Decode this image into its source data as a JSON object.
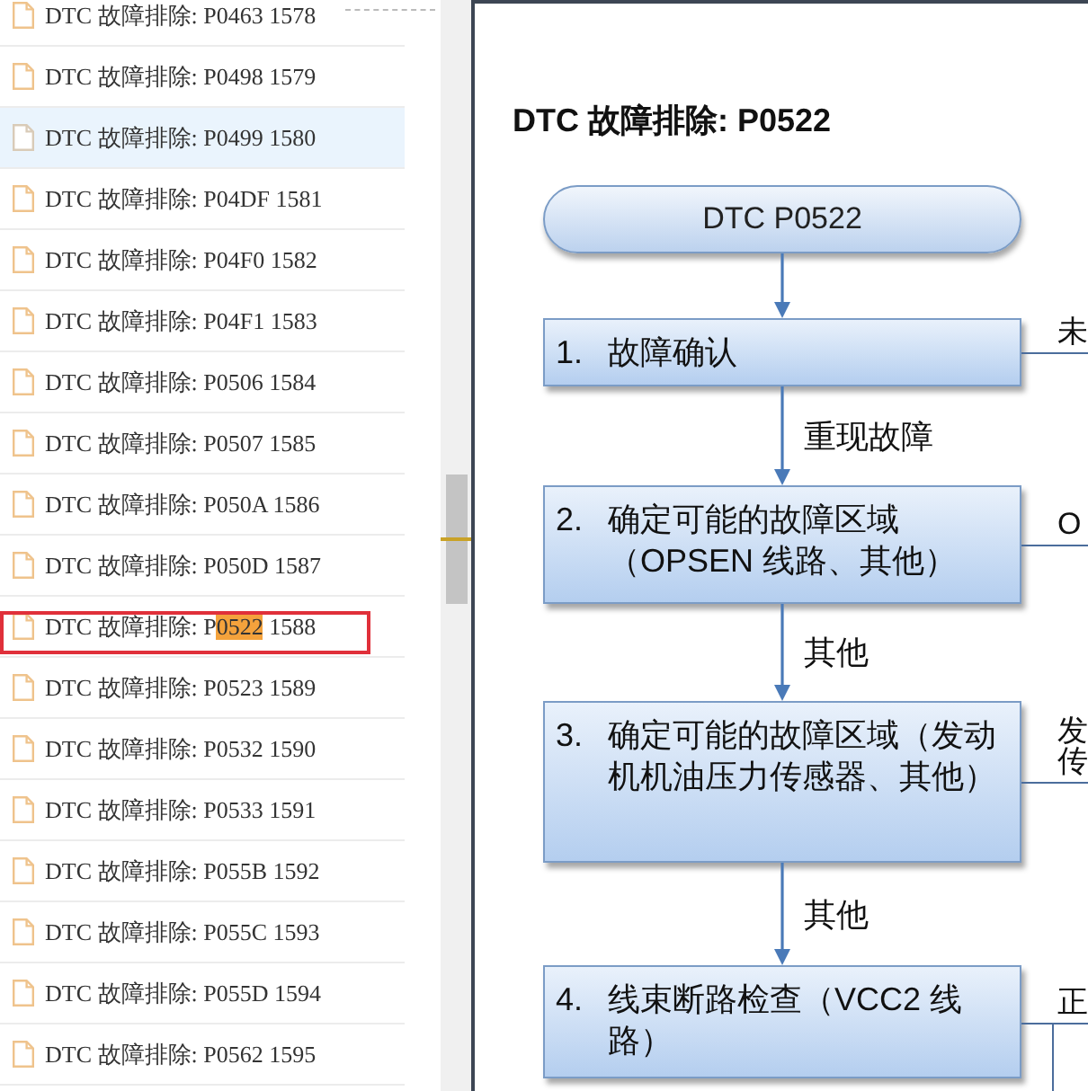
{
  "sidebar": {
    "items": [
      {
        "text": "DTC 故障排除: P0463 1578",
        "hovered": false,
        "marked": false
      },
      {
        "text": "DTC 故障排除: P0498 1579",
        "hovered": false,
        "marked": false
      },
      {
        "text": "DTC 故障排除: P0499 1580",
        "hovered": true,
        "marked": false
      },
      {
        "text": "DTC 故障排除: P04DF 1581",
        "hovered": false,
        "marked": false
      },
      {
        "text": "DTC 故障排除: P04F0 1582",
        "hovered": false,
        "marked": false
      },
      {
        "text": "DTC 故障排除: P04F1 1583",
        "hovered": false,
        "marked": false
      },
      {
        "text": "DTC 故障排除: P0506 1584",
        "hovered": false,
        "marked": false
      },
      {
        "text": "DTC 故障排除: P0507 1585",
        "hovered": false,
        "marked": false
      },
      {
        "text": "DTC 故障排除: P050A 1586",
        "hovered": false,
        "marked": false
      },
      {
        "text": "DTC 故障排除: P050D 1587",
        "hovered": false,
        "marked": false
      },
      {
        "segments": [
          {
            "text": "DTC 故障排除: P",
            "hit": false
          },
          {
            "text": "0522",
            "hit": true
          },
          {
            "text": " 1588",
            "hit": false
          }
        ],
        "hovered": false,
        "marked": true
      },
      {
        "text": "DTC 故障排除: P0523 1589",
        "hovered": false,
        "marked": false
      },
      {
        "text": "DTC 故障排除: P0532 1590",
        "hovered": false,
        "marked": false
      },
      {
        "text": "DTC 故障排除: P0533 1591",
        "hovered": false,
        "marked": false
      },
      {
        "text": "DTC 故障排除: P055B 1592",
        "hovered": false,
        "marked": false
      },
      {
        "text": "DTC 故障排除: P055C 1593",
        "hovered": false,
        "marked": false
      },
      {
        "text": "DTC 故障排除: P055D 1594",
        "hovered": false,
        "marked": false
      },
      {
        "text": "DTC 故障排除: P0562 1595",
        "hovered": false,
        "marked": false
      }
    ]
  },
  "document": {
    "title": "DTC 故障排除: P0522",
    "flowchart": {
      "start": "DTC P0522",
      "steps": [
        {
          "number": "1.",
          "text": "故障确认",
          "branch": {
            "kind": "right",
            "label": [
              "未"
            ]
          }
        },
        {
          "number": "2.",
          "text": "确定可能的故障区域（OPSEN 线路、其他）",
          "arrow_label": "重现故障",
          "branch": {
            "kind": "right",
            "label": [
              "O"
            ]
          }
        },
        {
          "number": "3.",
          "text": "确定可能的故障区域（发动机机油压力传感器、其他）",
          "arrow_label": "其他",
          "branch": {
            "kind": "right",
            "label": [
              "发",
              "传"
            ]
          }
        },
        {
          "number": "4.",
          "text": "线束断路检查（VCC2 线路）",
          "arrow_label": "其他",
          "branch": {
            "kind": "down",
            "label": [
              "正"
            ]
          }
        }
      ]
    }
  }
}
